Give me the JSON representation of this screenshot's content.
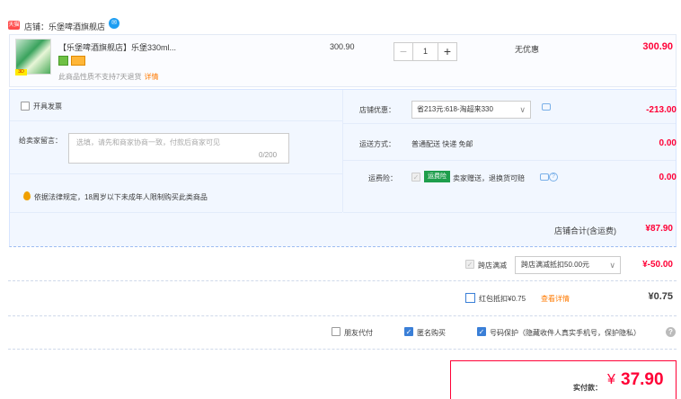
{
  "shop": {
    "badge": "天猫",
    "name_text": "店铺：乐堡啤酒旗舰店",
    "contact_icon": "wangwang-icon"
  },
  "item": {
    "title": "【乐堡啤酒旗舰店】乐堡330ml...",
    "thumb_tag": "3D",
    "note": "此商品性质不支持7天退货",
    "note_link": "详情",
    "unit_price": "300.90",
    "qty_minus": "−",
    "qty_value": "1",
    "qty_plus": "+",
    "discount": "无优惠",
    "total": "300.90"
  },
  "options": {
    "invoice_label": "开具发票",
    "message_label": "给卖家留言：",
    "message_placeholder": "选填，请先和商家协商一致，付款后商家可见",
    "message_count": "0/200",
    "law_text": "依据法律规定，18周岁以下未成年人限制购买此类商品",
    "shop_discount_label": "店铺优惠：",
    "shop_discount_select": "省213元:618-淘超来330",
    "shop_discount_amount": "-213.00",
    "shipping_label": "运送方式：",
    "shipping_value": "普通配送 快递 免邮",
    "shipping_amount": "0.00",
    "insurance_label": "运费险：",
    "insurance_badge": "运费险",
    "insurance_text": "卖家赠送，退换货可赔",
    "insurance_help": "?",
    "insurance_amount": "0.00"
  },
  "subtotal": {
    "label": "店铺合计(含运费)",
    "amount": "¥87.90"
  },
  "cross_store": {
    "label": "跨店满减",
    "select": "跨店满减抵扣50.00元",
    "amount": "¥-50.00"
  },
  "red_packet": {
    "label": "红包抵扣¥0.75",
    "link": "查看详情",
    "amount": "¥0.75"
  },
  "payment_options": {
    "friend_pay": "朋友代付",
    "anonymous": "匿名购买",
    "number_protect": "号码保护（隐藏收件人真实手机号，保护隐私）",
    "help": "?"
  },
  "final": {
    "label": "实付款：",
    "yen": "¥",
    "amount": "37.90"
  },
  "colors": {
    "price_red": "#ff0036",
    "link_orange": "#ff7a00",
    "check_blue": "#3a7fd7",
    "panel_bg": "#f2f7ff"
  }
}
